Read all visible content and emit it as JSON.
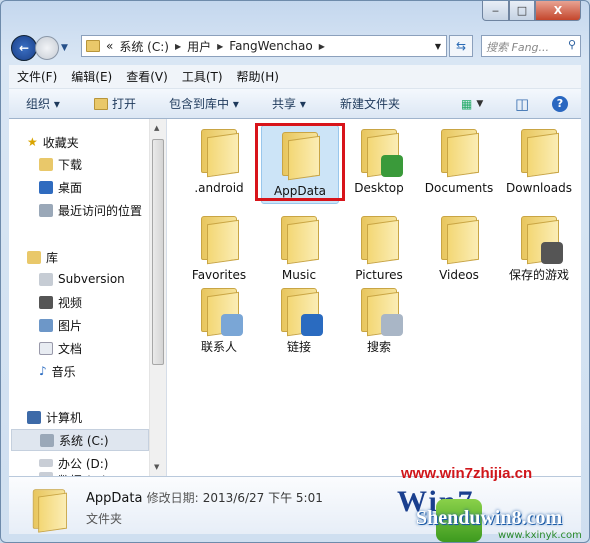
{
  "window": {
    "minimize": "‒",
    "maximize": "□",
    "close": "X"
  },
  "address": {
    "overflow": "«",
    "crumbs": [
      "系统 (C:)",
      "用户",
      "FangWenchao"
    ],
    "search_placeholder": "搜索 Fang..."
  },
  "menu": [
    "文件(F)",
    "编辑(E)",
    "查看(V)",
    "工具(T)",
    "帮助(H)"
  ],
  "toolbar": {
    "organize": "组织 ▾",
    "open": "打开",
    "include": "包含到库中 ▾",
    "share": "共享 ▾",
    "new_folder": "新建文件夹"
  },
  "sidebar": {
    "favorites": "收藏夹",
    "fav_items": [
      "下载",
      "桌面",
      "最近访问的位置"
    ],
    "libraries": "库",
    "lib_items": [
      "Subversion",
      "视频",
      "图片",
      "文档",
      "音乐"
    ],
    "computer": "计算机",
    "drives": [
      "系统 (C:)",
      "办公 (D:)",
      "数据 (E:)"
    ],
    "selected": "系统 (C:)"
  },
  "items": [
    ".android",
    "AppData",
    "Desktop",
    "Documents",
    "Downloads",
    "Favorites",
    "Music",
    "Pictures",
    "Videos",
    "保存的游戏",
    "联系人",
    "链接",
    "搜索"
  ],
  "selected_item": "AppData",
  "details": {
    "name": "AppData",
    "modified_label": "修改日期:",
    "modified": "2013/6/27 下午 5:01",
    "type": "文件夹"
  },
  "watermark": {
    "site1": "www.win7zhijia.cn",
    "logo": "Win7",
    "site2": "Shenduwin8.com",
    "site3": "www.kxinyk.com"
  },
  "colors": {
    "highlight": "#d8141a",
    "selection": "#cce4f7"
  }
}
